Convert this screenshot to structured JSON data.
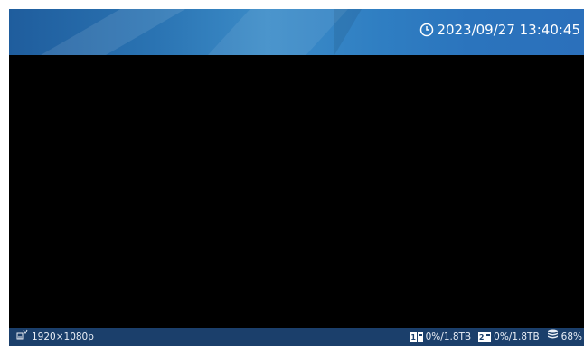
{
  "header": {
    "datetime": "2023/09/27 13:40:45",
    "clock_icon": "clock-icon"
  },
  "status": {
    "resolution": "1920×1080p",
    "resolution_icon": "signal-input-icon",
    "disks": [
      {
        "number": "1",
        "usage": "0%/1.8TB",
        "icon": "disk-icon"
      },
      {
        "number": "2",
        "usage": "0%/1.8TB",
        "icon": "disk-icon"
      }
    ],
    "storage_percent": "68%",
    "storage_icon": "storage-stack-icon"
  },
  "colors": {
    "header_blue": "#2b74bd",
    "status_bar": "#1b3f6b",
    "video_background": "#000000"
  }
}
